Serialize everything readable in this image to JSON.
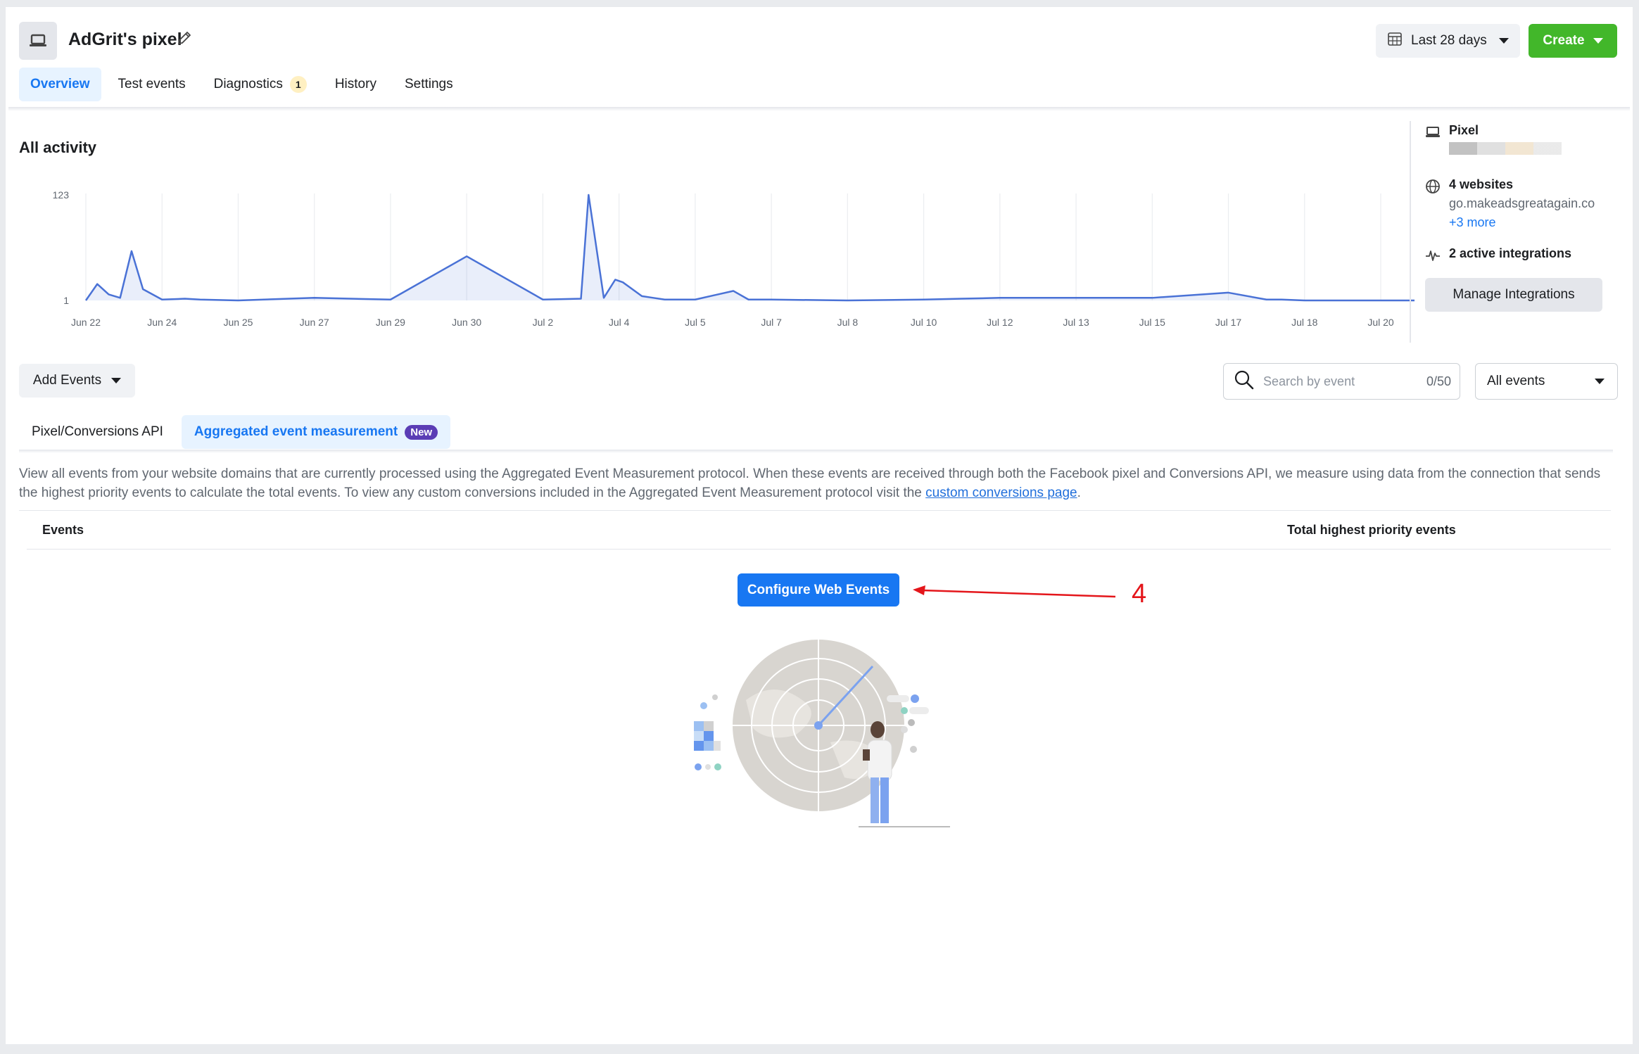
{
  "header": {
    "title": "AdGrit's pixel",
    "date_range": "Last 28 days",
    "create_label": "Create"
  },
  "tabs": [
    {
      "label": "Overview",
      "active": true
    },
    {
      "label": "Test events"
    },
    {
      "label": "Diagnostics",
      "badge": "1"
    },
    {
      "label": "History"
    },
    {
      "label": "Settings"
    }
  ],
  "activity": {
    "title": "All activity"
  },
  "chart_data": {
    "type": "area",
    "title": "",
    "ytick_labels": [
      "1",
      "123"
    ],
    "ylim": [
      1,
      123
    ],
    "x_tick_labels": [
      "Jun 22",
      "Jun 24",
      "Jun 25",
      "Jun 27",
      "Jun 29",
      "Jun 30",
      "Jul 2",
      "Jul 4",
      "Jul 5",
      "Jul 7",
      "Jul 8",
      "Jul 10",
      "Jul 12",
      "Jul 13",
      "Jul 15",
      "Jul 17",
      "Jul 18",
      "Jul 20"
    ],
    "series": [
      {
        "color": "#4a72d6",
        "x": [
          0,
          0.15,
          0.3,
          0.45,
          0.6,
          0.75,
          1,
          1.3,
          1.5,
          2,
          3,
          4,
          5,
          6,
          6.5,
          6.6,
          6.8,
          6.95,
          7.05,
          7.3,
          7.45,
          7.6,
          8,
          8.5,
          8.7,
          9,
          10,
          11,
          11.5,
          12,
          13,
          14,
          15,
          15.5,
          15.7,
          16,
          17,
          17.5
        ],
        "values": [
          1,
          20,
          8,
          4,
          58,
          14,
          2,
          3,
          2,
          1,
          4,
          2,
          52,
          2,
          3,
          123,
          4,
          25,
          22,
          6,
          4,
          2,
          2,
          12,
          2,
          2,
          1,
          2,
          3,
          4,
          4,
          4,
          10,
          2,
          2,
          1,
          1,
          1
        ]
      }
    ]
  },
  "side": {
    "pixel_label": "Pixel",
    "websites_label": "4 websites",
    "website_domain": "go.makeadsgreatagain.co",
    "more_link": "+3 more",
    "integrations_label": "2 active integrations",
    "manage_label": "Manage Integrations"
  },
  "filters": {
    "add_events_label": "Add Events",
    "search_placeholder": "Search by event",
    "search_count": "0/50",
    "event_filter": "All events"
  },
  "subtabs": [
    {
      "label": "Pixel/Conversions API"
    },
    {
      "label": "Aggregated event measurement",
      "badge": "New",
      "active": true
    }
  ],
  "description": {
    "text": "View all events from your website domains that are currently processed using the Aggregated Event Measurement protocol. When these events are received through both the Facebook pixel and Conversions API, we measure using data from the connection that sends the highest priority events to calculate the total events. To view any custom conversions included in the Aggregated Event Measurement protocol visit the ",
    "link": "custom conversions page",
    "after": "."
  },
  "table": {
    "col_events": "Events",
    "col_total": "Total highest priority events"
  },
  "configure_label": "Configure Web Events",
  "annotation": {
    "number": "4",
    "color": "#e4161b"
  },
  "colors": {
    "accent": "#1877f2",
    "create": "#42b72a",
    "new_badge": "#5b3db5"
  }
}
